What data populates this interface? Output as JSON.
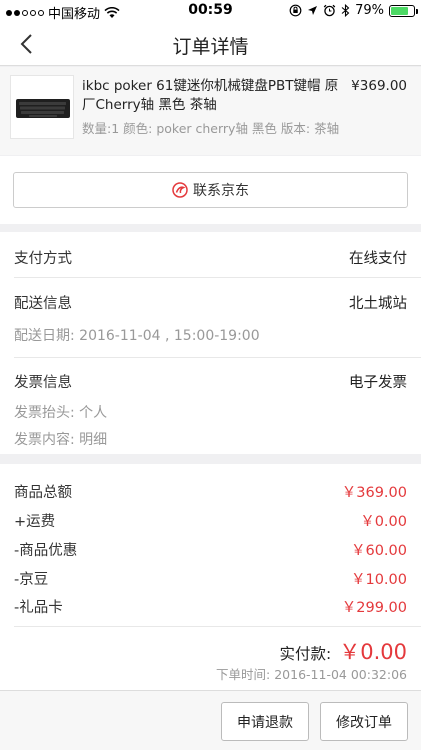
{
  "status_bar": {
    "carrier": "中国移动",
    "time": "00:59",
    "battery_percent": "79%",
    "battery_level": 0.79
  },
  "header": {
    "title": "订单详情",
    "back_icon": "chevron-left-icon"
  },
  "product": {
    "name": "ikbc poker 61键迷你机械键盘PBT键帽 原厂Cherry轴 黑色 茶轴",
    "price": "¥369.00",
    "spec": "数量:1   颜色: poker cherry轴 黑色   版本: 茶轴"
  },
  "contact": {
    "label": "联系京东",
    "icon": "jd-logo-icon"
  },
  "payment": {
    "label": "支付方式",
    "value": "在线支付"
  },
  "delivery": {
    "label": "配送信息",
    "value": "北土城站",
    "date": "配送日期:  2016-11-04 , 15:00-19:00"
  },
  "invoice": {
    "label": "发票信息",
    "value": "电子发票",
    "title": "发票抬头:  个人",
    "content": "发票内容:  明细"
  },
  "amounts": {
    "rows": [
      {
        "label": "商品总额",
        "value": "￥369.00"
      },
      {
        "label": "+运费",
        "value": "￥0.00"
      },
      {
        "label": "-商品优惠",
        "value": "￥60.00"
      },
      {
        "label": "-京豆",
        "value": "￥10.00"
      },
      {
        "label": "-礼品卡",
        "value": "￥299.00"
      }
    ],
    "paid_label": "实付款:",
    "paid_value": "￥0.00",
    "order_time": "下单时间:  2016-11-04 00:32:06"
  },
  "footer": {
    "refund_label": "申请退款",
    "modify_label": "修改订单"
  },
  "colors": {
    "accent_red": "#e4393c",
    "battery_green": "#4cd964"
  }
}
